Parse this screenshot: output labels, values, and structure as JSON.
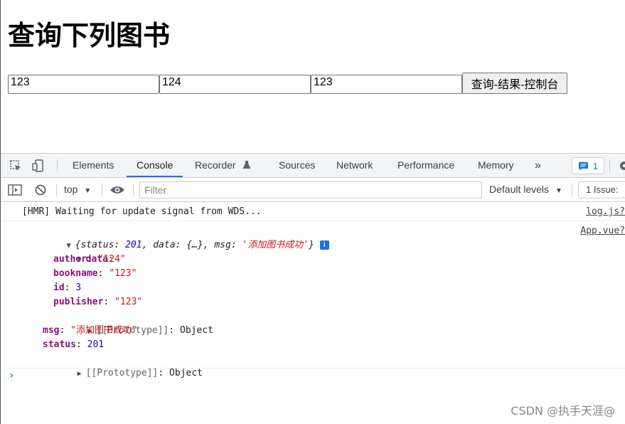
{
  "page": {
    "title": "查询下列图书",
    "fields": [
      "123",
      "124",
      "123"
    ],
    "query_button": "查询-结果-控制台"
  },
  "devtools": {
    "tabs": [
      "Elements",
      "Console",
      "Recorder",
      "Sources",
      "Network",
      "Performance",
      "Memory"
    ],
    "active_tab": "Console",
    "more_tabs_glyph": "»",
    "issues_badge_count": "1",
    "context": "top",
    "filter_placeholder": "Filter",
    "levels": "Default levels",
    "issue_count": "1 Issue:"
  },
  "console": {
    "hmr_message": "[HMR] Waiting for update signal from WDS...",
    "hmr_source": "log.js?",
    "object_source": "App.vue?",
    "object_summary": {
      "status_key": "status",
      "status_value": "201",
      "data_key": "data",
      "data_value": "{…}",
      "msg_key": "msg",
      "msg_value": "'添加图书成功'"
    },
    "data_key": "data",
    "data_props": [
      {
        "key": "author",
        "value": "\"124\"",
        "type": "str"
      },
      {
        "key": "bookname",
        "value": "\"123\"",
        "type": "str"
      },
      {
        "key": "id",
        "value": "3",
        "type": "num"
      },
      {
        "key": "publisher",
        "value": "\"123\"",
        "type": "str"
      }
    ],
    "proto_label": "[[Prototype]]",
    "proto_value": "Object",
    "msg_key": "msg",
    "msg_value": "\"添加图书成功\"",
    "status_key": "status",
    "status_value": "201"
  },
  "watermark": "CSDN @执手天涯@"
}
